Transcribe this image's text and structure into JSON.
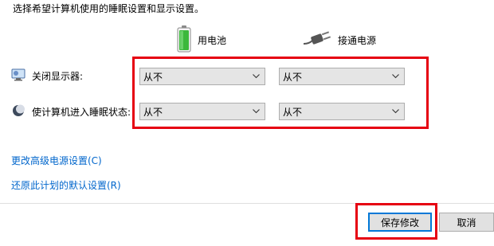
{
  "header": {
    "instruction": "选择希望计算机使用的睡眠设置和显示设置。"
  },
  "columns": {
    "battery": {
      "label": "用电池",
      "icon": "battery-icon"
    },
    "plugged_in": {
      "label": "接通电源",
      "icon": "power-plug-icon"
    }
  },
  "settings": [
    {
      "label": "关闭显示器:",
      "icon": "monitor-icon",
      "battery_value": "从不",
      "plugged_value": "从不"
    },
    {
      "label": "使计算机进入睡眠状态:",
      "icon": "moon-icon",
      "battery_value": "从不",
      "plugged_value": "从不"
    }
  ],
  "links": {
    "advanced": "更改高级电源设置(C)",
    "restore": "还原此计划的默认设置(R)"
  },
  "buttons": {
    "save": "保存修改",
    "cancel": "取消"
  },
  "colors": {
    "highlight": "#e60012",
    "link": "#0066cc",
    "focus_border": "#0078d7",
    "battery_green": "#3cb83c"
  }
}
